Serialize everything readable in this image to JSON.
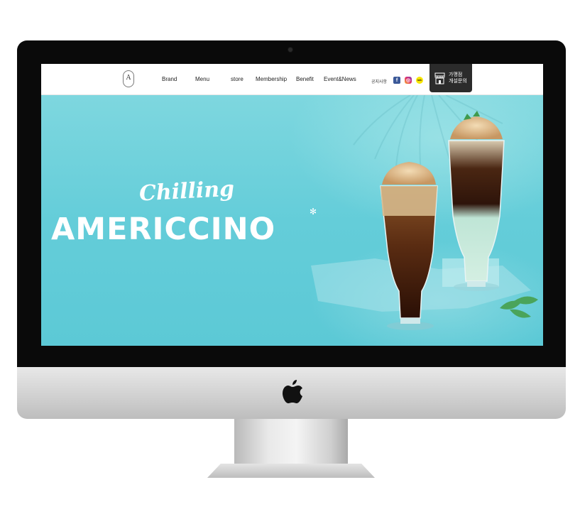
{
  "nav": {
    "logo": "A",
    "items": [
      {
        "label": "Brand"
      },
      {
        "label": "Menu"
      },
      {
        "label": "store"
      },
      {
        "label": "Membership"
      },
      {
        "label": "Benefit"
      },
      {
        "label": "Event&News"
      }
    ],
    "notice": "공지사항",
    "social": {
      "facebook": "f",
      "instagram": "◎",
      "kakao": "talk"
    },
    "franchise": {
      "line1": "가맹점",
      "line2": "개설문의"
    }
  },
  "hero": {
    "script_title": "Chilling",
    "title": "AMERICCINO",
    "snowflake": "✻"
  },
  "colors": {
    "hero_bg": "#64cdd9",
    "nav_bg": "#ffffff",
    "franchise_bg": "#2b2b2b"
  },
  "icons": [
    "apple-logo-icon",
    "facebook-icon",
    "instagram-icon",
    "kakaotalk-icon",
    "store-icon",
    "snowflake-icon"
  ]
}
